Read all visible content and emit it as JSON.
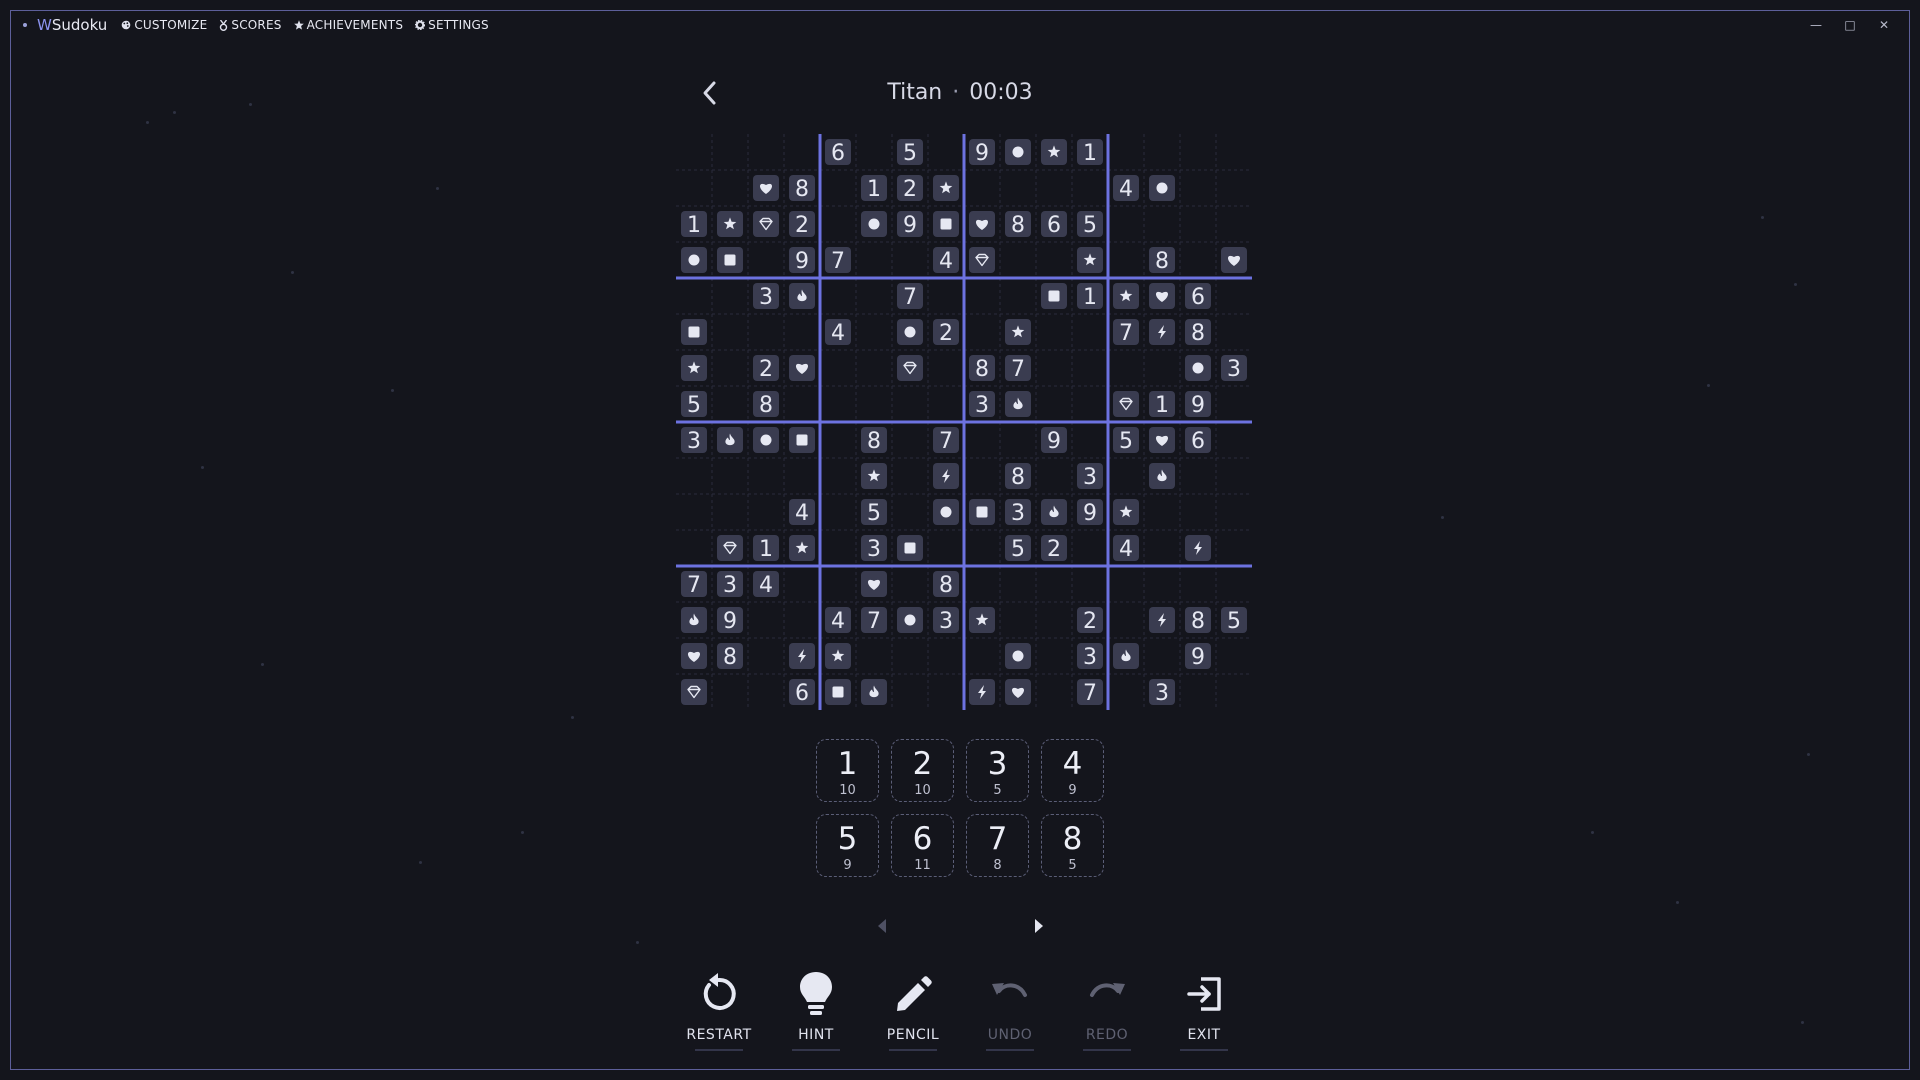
{
  "app": {
    "title_prefix": "W",
    "title_rest": "Sudoku",
    "menu": [
      {
        "label": "CUSTOMIZE",
        "icon": "palette-icon"
      },
      {
        "label": "SCORES",
        "icon": "medal-icon"
      },
      {
        "label": "ACHIEVEMENTS",
        "icon": "star-icon"
      },
      {
        "label": "SETTINGS",
        "icon": "gear-icon"
      }
    ],
    "window_controls": {
      "minimize": "—",
      "maximize": "□",
      "close": "✕"
    }
  },
  "game": {
    "difficulty": "Titan",
    "separator": "·",
    "timer": "00:03"
  },
  "board": {
    "size": 16,
    "box_width": 4,
    "box_height": 4,
    "rows": [
      "    6 5 9cs1   ",
      "  h8 12s    4c   ",
      "1sd2 c9qh865    ",
      "cq 97  4d  s 8 h",
      "  3f  7   q1sh6 ",
      "q   4 c2 s  7z8",
      "s 2h  d 87    c3",
      "5 8     3f  d19",
      "3fcq 8 7  9 5h6",
      "     s z 8 3 f ",
      "   4 5 cq3f9s  ",
      " d1s 3q  52 4 z",
      "734  h 8        ",
      "f9  47c3s  2 z85",
      "h8 zs    c 3f 9 ",
      "d  6qf  zh 7 3 "
    ]
  },
  "number_pad": {
    "keys": [
      {
        "digit": "1",
        "count": "10"
      },
      {
        "digit": "2",
        "count": "10"
      },
      {
        "digit": "3",
        "count": "5"
      },
      {
        "digit": "4",
        "count": "9"
      },
      {
        "digit": "5",
        "count": "9"
      },
      {
        "digit": "6",
        "count": "11"
      },
      {
        "digit": "7",
        "count": "8"
      },
      {
        "digit": "8",
        "count": "5"
      }
    ]
  },
  "toolbar": {
    "restart": "RESTART",
    "hint": "HINT",
    "pencil": "PENCIL",
    "undo": "UNDO",
    "redo": "REDO",
    "exit": "EXIT"
  },
  "colors": {
    "background": "#14151c",
    "accent": "#8c93ef",
    "box_line": "#6d72e0",
    "cell_tile": "#3a3c50",
    "text": "#e6e8f2"
  }
}
